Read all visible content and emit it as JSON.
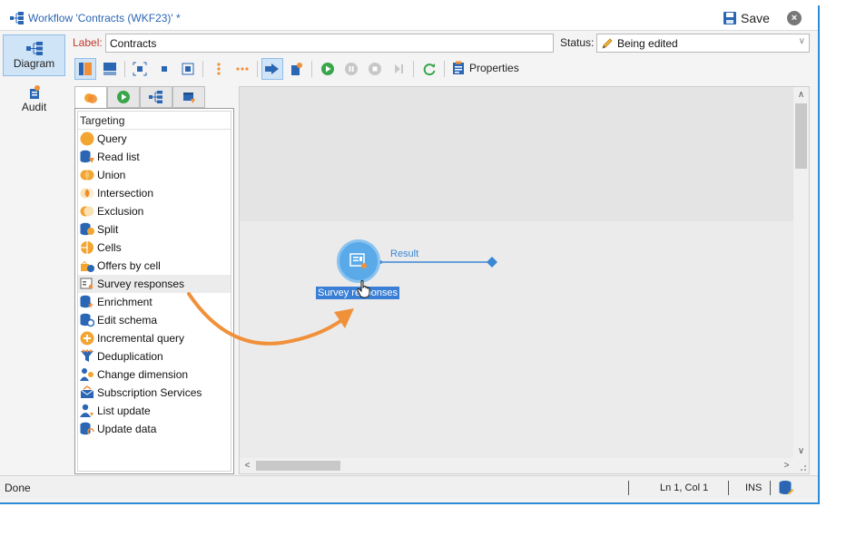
{
  "window": {
    "title": "Workflow 'Contracts (WKF23)' *",
    "save_label": "Save"
  },
  "nav": {
    "items": [
      {
        "label": "Diagram",
        "icon": "diagram-icon",
        "active": true
      },
      {
        "label": "Audit",
        "icon": "audit-icon",
        "active": false
      }
    ]
  },
  "header": {
    "label_caption": "Label:",
    "label_value": "Contracts",
    "status_caption": "Status:",
    "status_value": "Being edited"
  },
  "toolbar": {
    "properties_label": "Properties"
  },
  "palette": {
    "tabs": [
      "targeting-tab",
      "flow-control-tab",
      "actions-tab",
      "events-tab"
    ],
    "header": "Targeting",
    "items": [
      {
        "label": "Query",
        "icon": "query-icon"
      },
      {
        "label": "Read list",
        "icon": "read-list-icon"
      },
      {
        "label": "Union",
        "icon": "union-icon"
      },
      {
        "label": "Intersection",
        "icon": "intersection-icon"
      },
      {
        "label": "Exclusion",
        "icon": "exclusion-icon"
      },
      {
        "label": "Split",
        "icon": "split-icon"
      },
      {
        "label": "Cells",
        "icon": "cells-icon"
      },
      {
        "label": "Offers by cell",
        "icon": "offers-by-cell-icon"
      },
      {
        "label": "Survey responses",
        "icon": "survey-responses-icon"
      },
      {
        "label": "Enrichment",
        "icon": "enrichment-icon"
      },
      {
        "label": "Edit schema",
        "icon": "edit-schema-icon"
      },
      {
        "label": "Incremental query",
        "icon": "incremental-query-icon"
      },
      {
        "label": "Deduplication",
        "icon": "deduplication-icon"
      },
      {
        "label": "Change dimension",
        "icon": "change-dimension-icon"
      },
      {
        "label": "Subscription Services",
        "icon": "subscription-services-icon"
      },
      {
        "label": "List update",
        "icon": "list-update-icon"
      },
      {
        "label": "Update data",
        "icon": "update-data-icon"
      }
    ]
  },
  "canvas": {
    "activity_label": "Survey responses",
    "transition_label": "Result"
  },
  "statusbar": {
    "state": "Done",
    "position": "Ln 1, Col 1",
    "mode": "INS"
  },
  "colors": {
    "accent": "#2e8bd6",
    "activity": "#5aa9e8",
    "selection": "#3a7fd5",
    "arrow": "#f0913a",
    "label_caption": "#c0392b"
  }
}
